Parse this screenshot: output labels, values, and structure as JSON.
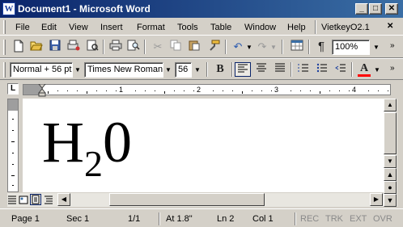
{
  "window": {
    "title": "Document1 - Microsoft Word",
    "app_icon": "W",
    "minimize": "_",
    "maximize": "□",
    "close": "✕"
  },
  "menubar": {
    "items": [
      "File",
      "Edit",
      "View",
      "Insert",
      "Format",
      "Tools",
      "Table",
      "Window",
      "Help"
    ],
    "extra": "VietkeyO2.1",
    "close": "✕"
  },
  "toolbar": {
    "zoom": "100%"
  },
  "formatting": {
    "style": "Normal + 56 pt",
    "font": "Times New Roman",
    "size": "56",
    "bold": "B"
  },
  "ruler": {
    "numbers": [
      "1",
      "2",
      "3",
      "4"
    ],
    "corner": "L"
  },
  "document": {
    "base": "H",
    "subscript": "2",
    "after": "0"
  },
  "statusbar": {
    "page": "Page 1",
    "sec": "Sec 1",
    "pages": "1/1",
    "at": "At 1.8\"",
    "ln": "Ln 2",
    "col": "Col 1",
    "rec": "REC",
    "trk": "TRK",
    "ext": "EXT",
    "ovr": "OVR"
  },
  "colors": {
    "title_start": "#0a246a",
    "title_end": "#3a6ea5",
    "font_color": "#ff0000"
  }
}
